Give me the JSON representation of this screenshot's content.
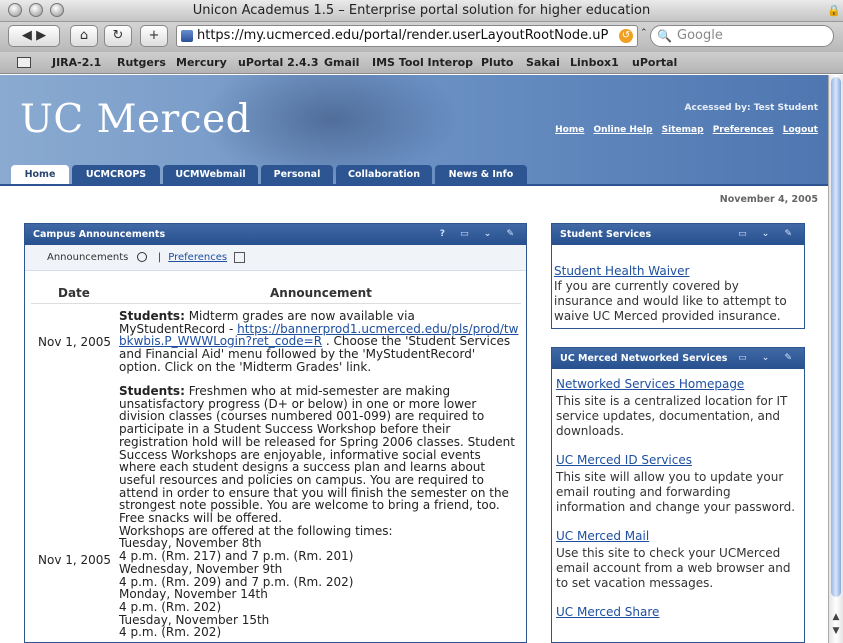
{
  "window": {
    "title": "Unicon Academus 1.5 – Enterprise portal solution for higher education"
  },
  "toolbar": {
    "back": "◀",
    "forward": "▶",
    "home": "⌂",
    "reload": "↻",
    "add": "+",
    "url": "https://my.ucmerced.edu/portal/render.userLayoutRootNode.uP",
    "search_placeholder": "Google"
  },
  "bookmarks": [
    "JIRA-2.1",
    "Rutgers",
    "Mercury",
    "uPortal 2.4.3",
    "Gmail",
    "IMS Tool Interop",
    "Pluto",
    "Sakai",
    "Linbox1",
    "uPortal"
  ],
  "header": {
    "logo": "UC Merced",
    "accessed": "Accessed by: Test Student",
    "links": [
      "Home",
      "Online Help",
      "Sitemap",
      "Preferences",
      "Logout"
    ]
  },
  "tabs": [
    "Home",
    "UCMCROPS",
    "UCMWebmail",
    "Personal",
    "Collaboration",
    "News & Info"
  ],
  "date": "November 4, 2005",
  "announcements": {
    "title": "Campus Announcements",
    "tool_label": "Announcements",
    "pref_label": "Preferences",
    "separator": "|",
    "col_date": "Date",
    "col_ann": "Announcement",
    "items": [
      {
        "date": "Nov 1, 2005",
        "label": "Students:",
        "text_a": " Midterm grades are now available via MyStudentRecord - ",
        "link": "https://bannerprod1.ucmerced.edu/pls/prod/twbkwbis.P_WWWLogin?ret_code=R",
        "text_b": " . Choose the 'Student Services and Financial Aid' menu followed by the 'MyStudentRecord' option. Click on the 'Midterm Grades' link."
      },
      {
        "date": "Nov 1, 2005",
        "label": "Students:",
        "text_a": " Freshmen who at mid-semester are making unsatisfactory progress (D+ or below) in one or more lower division classes (courses numbered 001-099) are required to participate in a Student Success Workshop before their registration hold will be released for Spring 2006 classes. Student Success Workshops are enjoyable, informative social events where each student designs a success plan and learns about useful resources and policies on campus. You are required to attend in order to ensure that you will finish the semester on the strongest note possible. You are welcome to bring a friend, too. Free snacks will be offered.",
        "lines": [
          "Workshops are offered at the following times:",
          "Tuesday, November 8th",
          "4 p.m. (Rm. 217) and 7 p.m. (Rm. 201)",
          "Wednesday, November 9th",
          "4 p.m. (Rm. 209) and 7 p.m. (Rm. 202)",
          "Monday, November 14th",
          "4 p.m. (Rm. 202)",
          "Tuesday, November 15th",
          "4 p.m. (Rm. 202)"
        ]
      }
    ]
  },
  "student_services": {
    "title": "Student Services",
    "link": "Student Health Waiver",
    "desc": "If you are currently covered by insurance and would like to attempt to waive UC Merced provided insurance."
  },
  "networked_services": {
    "title": "UC Merced Networked Services",
    "items": [
      {
        "link": "Networked Services Homepage",
        "desc": "This site is a centralized location for IT service updates, documentation, and downloads."
      },
      {
        "link": "UC Merced ID Services",
        "desc": "This site will allow you to update your email routing and forwarding information and change your password."
      },
      {
        "link": "UC Merced Mail",
        "desc": "Use this site to check your UCMerced email account from a web browser and to set vacation messages."
      },
      {
        "link": "UC Merced Share",
        "desc": ""
      }
    ]
  },
  "channel_icons": "? ▭ ⌄ ✎",
  "channel_icons_short": "▭ ⌄ ✎",
  "colors": {
    "tab": "#2c5592",
    "link": "#1e4fa0"
  }
}
